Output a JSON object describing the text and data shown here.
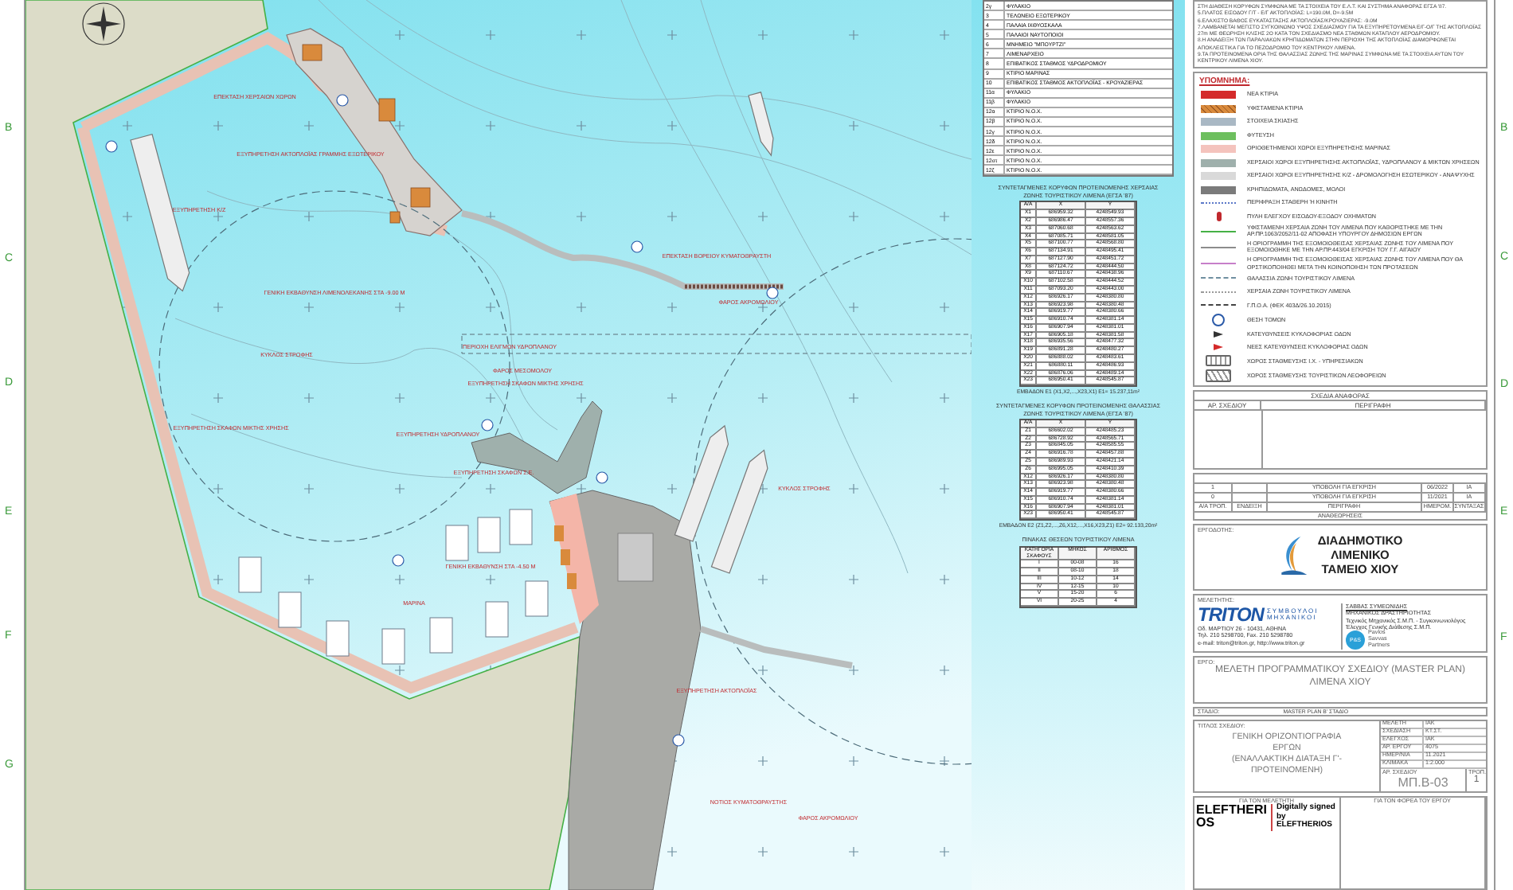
{
  "margin_letters": {
    "left": [
      "B",
      "C",
      "D",
      "E",
      "F",
      "G"
    ],
    "right": [
      "B",
      "C",
      "D",
      "E",
      "F"
    ]
  },
  "map": {
    "labels": [
      "ΕΠΕΚΤΑΣΗ ΧΕΡΣΑΙΩΝ ΧΩΡΩΝ",
      "ΕΞΥΠΗΡΕΤΗΣΗ ΑΚΤΟΠΛΟΪΑΣ ΓΡΑΜΜΗΣ ΕΞΩΤΕΡΙΚΟΥ",
      "ΕΞΥΠΗΡΕΤΗΣΗ Κ/Ζ",
      "ΓΕΝΙΚΗ ΕΚΒΑΘΥΝΣΗ ΛΙΜΕΝΟΛΕΚΑΝΗΣ ΣΤΑ -9.00 Μ",
      "ΚΥΚΛΟΣ ΣΤΡΟΦΗΣ",
      "ΕΞΥΠΗΡΕΤΗΣΗ ΣΚΑΦΩΝ ΜΙΚΤΗΣ ΧΡΗΣΗΣ",
      "ΕΞΥΠΗΡΕΤΗΣΗ ΥΔΡΟΠΛΑΝΟΥ",
      "ΕΞΥΠΗΡΕΤΗΣΗ ΣΚΑΦΩΝ Σ.Ε.",
      "ΦΑΡΟΣ ΜΕΣΟΜΟΛΟΥ",
      "ΕΞΥΠΗΡΕΤΗΣΗ ΣΚΑΦΩΝ ΜΙΚΤΗΣ ΧΡΗΣΗΣ",
      "ΓΕΝΙΚΗ ΕΚΒΑΘΥΝΣΗ ΣΤΑ -4.50 Μ",
      "ΜΑΡΙΝΑ",
      "ΕΠΕΚΤΑΣΗ ΒΟΡΕΙΟΥ ΚΥΜΑΤΟΘΡΑΥΣΤΗ",
      "ΦΑΡΟΣ ΑΚΡΟΜΩΛΙΟΥ",
      "ΠΕΡΙΟΧΗ ΕΛΙΓΜΩΝ ΥΔΡΟΠΛΑΝΟΥ",
      "ΚΥΚΛΟΣ ΣΤΡΟΦΗΣ",
      "ΕΞΥΠΗΡΕΤΗΣΗ ΑΚΤΟΠΛΟΪΑΣ",
      "ΝΟΤΙΟΣ ΚΥΜΑΤΟΘΡΑΥΣΤΗΣ",
      "ΦΑΡΟΣ ΑΚΡΟΜΩΛΙΟΥ"
    ]
  },
  "buildings_table": {
    "rows": [
      {
        "no": "2γ",
        "name": "ΦΥΛΑΚΙΟ"
      },
      {
        "no": "3",
        "name": "ΤΕΛΩΝΕΙΟ ΕΞΩΤΕΡΙΚΟΥ"
      },
      {
        "no": "4",
        "name": "ΠΑΛΑΙΑ ΙΧΘΥΟΣΚΑΛΑ"
      },
      {
        "no": "5",
        "name": "ΠΑΛΑΙΟΙ ΝΑΥΤΟΠΟΙΟΙ"
      },
      {
        "no": "6",
        "name": "ΜΝΗΜΕΙΟ \"ΜΠΟΥΡΤΖΙ\""
      },
      {
        "no": "7",
        "name": "ΛΙΜΕΝΑΡΧΕΙΟ"
      },
      {
        "no": "8",
        "name": "ΕΠΙΒΑΤΙΚΟΣ ΣΤΑΘΜΟΣ ΥΔΡΟΔΡΟΜΙΟΥ"
      },
      {
        "no": "9",
        "name": "ΚΤΙΡΙΟ ΜΑΡΙΝΑΣ"
      },
      {
        "no": "10",
        "name": "ΕΠΙΒΑΤΙΚΟΣ ΣΤΑΘΜΟΣ ΑΚΤΟΠΛΟΪΑΣ - ΚΡΟΥΑΖΙΕΡΑΣ"
      },
      {
        "no": "11α",
        "name": "ΦΥΛΑΚΙΟ"
      },
      {
        "no": "11β",
        "name": "ΦΥΛΑΚΙΟ"
      },
      {
        "no": "12α",
        "name": "ΚΤΙΡΙΟ Ν.Ο.Χ."
      },
      {
        "no": "12β",
        "name": "ΚΤΙΡΙΟ Ν.Ο.Χ."
      },
      {
        "no": "12γ",
        "name": "ΚΤΙΡΙΟ Ν.Ο.Χ."
      },
      {
        "no": "12δ",
        "name": "ΚΤΙΡΙΟ Ν.Ο.Χ."
      },
      {
        "no": "12ε",
        "name": "ΚΤΙΡΙΟ Ν.Ο.Χ."
      },
      {
        "no": "12στ",
        "name": "ΚΤΙΡΙΟ Ν.Ο.Χ."
      },
      {
        "no": "12ζ",
        "name": "ΚΤΙΡΙΟ Ν.Ο.Χ."
      }
    ]
  },
  "coordinate_tables": [
    {
      "title": "ΣΥΝΤΕΤΑΓΜΕΝΕΣ ΚΟΡΥΦΩΝ ΠΡΟΤΕΙΝΟΜΕΝΗΣ ΧΕΡΣΑΙΑΣ ΖΩΝΗΣ ΤΟΥΡΙΣΤΙΚΟΥ ΛΙΜΕΝΑ (ΕΓΣΑ '87)",
      "columns": [
        "Α/Α",
        "X",
        "Y"
      ],
      "rows": [
        [
          "X1",
          "686959.32",
          "4248549.93"
        ],
        [
          "X2",
          "686986.47",
          "4248557.36"
        ],
        [
          "X3",
          "687060.68",
          "4248563.62"
        ],
        [
          "X4",
          "687085.71",
          "4248581.05"
        ],
        [
          "X5",
          "687100.77",
          "4248568.80"
        ],
        [
          "X6",
          "687134.91",
          "4248495.41"
        ],
        [
          "X7",
          "687127.90",
          "4248451.72"
        ],
        [
          "X8",
          "687124.72",
          "4248444.50"
        ],
        [
          "X9",
          "687110.67",
          "4248438.96"
        ],
        [
          "X10",
          "687102.58",
          "4248444.52"
        ],
        [
          "X11",
          "687093.20",
          "4248443.00"
        ],
        [
          "X12",
          "686926.17",
          "4248380.80"
        ],
        [
          "X13",
          "686923.98",
          "4248380.48"
        ],
        [
          "X14",
          "686919.77",
          "4248380.66"
        ],
        [
          "X15",
          "686910.74",
          "4248381.14"
        ],
        [
          "X16",
          "686907.94",
          "4248381.01"
        ],
        [
          "X17",
          "686905.18",
          "4248381.58"
        ],
        [
          "X18",
          "686935.56",
          "4248477.32"
        ],
        [
          "X19",
          "686891.28",
          "4248480.27"
        ],
        [
          "X20",
          "686888.02",
          "4248483.61"
        ],
        [
          "X21",
          "686880.11",
          "4248486.93"
        ],
        [
          "X22",
          "686876.06",
          "4248489.14"
        ],
        [
          "X23",
          "686950.41",
          "4248545.87"
        ]
      ],
      "area": "ΕΜΒΑΔΟΝ Ε1 (Χ1,Χ2,...,Χ23,Χ1) Ε1= 15.237,11m²"
    },
    {
      "title": "ΣΥΝΤΕΤΑΓΜΕΝΕΣ ΚΟΡΥΦΩΝ ΠΡΟΤΕΙΝΟΜΕΝΗΣ ΘΑΛΑΣΣΙΑΣ ΖΩΝΗΣ ΤΟΥΡΙΣΤΙΚΟΥ ΛΙΜΕΝΑ (ΕΓΣΑ '87)",
      "columns": [
        "Α/Α",
        "X",
        "Y"
      ],
      "rows": [
        [
          "Ζ1",
          "686602.02",
          "4248485.23"
        ],
        [
          "Ζ2",
          "686728.92",
          "4248565.71"
        ],
        [
          "Ζ3",
          "686845.05",
          "4248585.55"
        ],
        [
          "Ζ4",
          "686916.78",
          "4248457.88"
        ],
        [
          "Ζ5",
          "686989.93",
          "4248421.14"
        ],
        [
          "Ζ6",
          "686995.05",
          "4248410.39"
        ],
        [
          "X12",
          "686926.17",
          "4248380.80"
        ],
        [
          "X13",
          "686923.98",
          "4248380.48"
        ],
        [
          "X14",
          "686919.77",
          "4248380.66"
        ],
        [
          "X15",
          "686910.74",
          "4248381.14"
        ],
        [
          "X16",
          "686907.94",
          "4248381.01"
        ],
        [
          "X23",
          "686950.41",
          "4248545.87"
        ]
      ],
      "area": "ΕΜΒΑΔΟΝ Ε2 (Ζ1,Ζ2,...,Ζ6,Χ12,...,Χ16,Χ23,Ζ1) Ε2= 92.133,20m²"
    }
  ],
  "berths_table": {
    "title": "ΠΙΝΑΚΑΣ ΘΕΣΕΩΝ ΤΟΥΡΙΣΤΙΚΟΥ ΛΙΜΕΝΑ",
    "columns": [
      "ΚΑΤΗΓΟΡΙΑ ΣΚΑΦΟΥΣ",
      "ΜΗΚΟΣ",
      "ΑΡΙΘΜΟΣ"
    ],
    "rows": [
      [
        "I",
        "00-08",
        "16"
      ],
      [
        "II",
        "08-10",
        "18"
      ],
      [
        "III",
        "10-12",
        "14"
      ],
      [
        "IV",
        "12-15",
        "10"
      ],
      [
        "V",
        "15-20",
        "6"
      ],
      [
        "VI",
        "20-25",
        "4"
      ]
    ]
  },
  "notes": [
    "ΣΤΗ ΔΙΑΘΕΣΗ ΚΟΡΥΦΩΝ ΣΥΜΦΩΝΑ ΜΕ ΤΑ ΣΤΟΙΧΕΙΑ ΤΟΥ Ε.Λ.Τ. ΚΑΙ ΣΥΣΤΗΜΑ ΑΝΑΦΟΡΑΣ ΕΓΣΑ '87.",
    "5.ΠΛΑΤΟΣ ΕΙΣΟΔΟΥ Γ/Τ - Ε/Γ ΑΚΤΟΠΛΟΪΑΣ: L=190.0Μ, D=-9.5Μ",
    "6.ΕΛΑΧΙΣΤΟ ΒΑΘΟΣ ΕΥΚΑΤΑΣΤΑΣΗΣ ΑΚΤΟΠΛΟΪΑΣ/ΚΡΟΥΑΖΙΕΡΑΣ: -9.0Μ",
    "7.ΛΑΜΒΑΝΕΤΑΙ ΜΕΓΙΣΤΟ ΣΥΓΚΟΙΝΩΝΟ ΥΨΟΣ ΣΧΕΔΙΑΣΜΟΥ ΓΙΑ ΤΑ ΕΞΥΠΗΡΕΤΟΥΜΕΝΑ Ε/Γ-Ο/Γ ΤΗΣ ΑΚΤΟΠΛΟΪΑΣ 27m ΜΕ ΘΕΩΡΗΣΗ ΚΛΙΣΗΣ 2Ο ΚΑΤΑ ΤΟΝ ΣΧΕΔΙΑΣΜΟ ΝΕΑ ΣΤΑΘΜΩΝ ΚΑΤΑΠΛΟΥ ΑΕΡΟΔΡΟΜΙΟΥ.",
    "8.Η ΑΝΑΔΕΙΞΗ ΤΩΝ ΠΑΡΑΛΙΑΚΩΝ ΚΡΗΠΙΔΩΜΑΤΩΝ ΣΤΗΝ ΠΕΡΙΟΧΗ ΤΗΣ ΑΚΤΟΠΛΟΪΑΣ ΔΙΑΜΟΡΦΩΝΕΤΑΙ ΑΠΟΚΛΕΙΣΤΙΚΑ ΓΙΑ ΤΟ ΠΕΖΟΔΡΟΜΙΟ ΤΟΥ ΚΕΝΤΡΙΚΟΥ ΛΙΜΕΝΑ.",
    "9.ΤΑ ΠΡΟΤΕΙΝΟΜΕΝΑ ΟΡΙΑ ΤΗΣ ΘΑΛΑΣΣΙΑΣ ΖΩΝΗΣ ΤΗΣ ΜΑΡΙΝΑΣ ΣΥΜΦΩΝΑ ΜΕ ΤΑ ΣΤΟΙΧΕΙΑ ΑΥΤΩΝ ΤΟΥ ΚΕΝΤΡΙΚΟΥ ΛΙΜΕΝΑ ΧΙΟΥ."
  ],
  "legend": {
    "title": "ΥΠΟΜΝΗΜΑ:",
    "items": [
      {
        "kind": "swatch",
        "color": "#d42a2a",
        "label": "ΝΕΑ ΚΤΙΡΙΑ"
      },
      {
        "kind": "hatch",
        "color": "#d98a3c",
        "label": "ΥΦΙΣΤΑΜΕΝΑ ΚΤΙΡΙΑ"
      },
      {
        "kind": "swatch",
        "color": "#a9b8c4",
        "label": "ΣΤΟΙΧΕΙΑ ΣΚΙΑΣΗΣ"
      },
      {
        "kind": "swatch",
        "color": "#6dbf5e",
        "label": "ΦΥΤΕΥΣΗ"
      },
      {
        "kind": "swatch",
        "color": "#f4c3bd",
        "label": "ΟΡΙΟΘΕΤΗΜΕΝΟΙ ΧΩΡΟΙ ΕΞΥΠΗΡΕΤΗΣΗΣ ΜΑΡΙΝΑΣ"
      },
      {
        "kind": "swatch",
        "color": "#9fb0ac",
        "label": "ΧΕΡΣΑΙΟΙ ΧΩΡΟΙ ΕΞΥΠΗΡΕΤΗΣΗΣ ΑΚΤΟΠΛΟΪΑΣ, ΥΔΡΟΠΛΑΝΟΥ & ΜΙΚΤΩΝ ΧΡΗΣΕΩΝ"
      },
      {
        "kind": "swatch",
        "color": "#d9d9d9",
        "label": "ΧΕΡΣΑΙΟΙ ΧΩΡΟΙ ΕΞΥΠΗΡΕΤΗΣΗΣ Κ/Ζ - ΔΡΟΜΟΛΟΓΗΣΗ ΕΣΩΤΕΡΙΚΟΥ - ΑΝΑΨΥΧΗΣ"
      },
      {
        "kind": "swatch",
        "color": "#7b7b7b",
        "label": "ΚΡΗΠΙΔΩΜΑΤΑ, ΑΝΩΔΟΜΕΣ, ΜΟΛΟΙ"
      },
      {
        "kind": "dotted",
        "color": "#5b78c8",
        "label": "ΠΕΡΙΦΡΑΞΗ ΣΤΑΘΕΡΗ Ή ΚΙΝΗΤΗ"
      },
      {
        "kind": "gate",
        "color": "#c0282d",
        "label": "ΠΥΛΗ ΕΛΕΓΧΟΥ ΕΙΣΟΔΟΥ-ΕΞΟΔΟΥ ΟΧΗΜΑΤΩΝ"
      },
      {
        "kind": "line",
        "color": "#45b045",
        "label": "ΥΦΙΣΤΑΜΕΝΗ ΧΕΡΣΑΙΑ ΖΩΝΗ ΤΟΥ ΛΙΜΕΝΑ ΠΟΥ ΚΑΘΟΡΙΣΤΗΚΕ ΜΕ ΤΗΝ ΑΡ.ΠΡ.1063/2052/11-02 ΑΠΟΦΑΣΗ ΥΠΟΥΡΓΟΥ ΔΗΜΟΣΙΩΝ ΕΡΓΩΝ"
      },
      {
        "kind": "line",
        "color": "#8c8c8c",
        "label": "Η ΟΡΙΟΓΡΑΜΜΗ ΤΗΣ ΕΞΟΜΟΙΩΘΕΙΣΑΣ ΧΕΡΣΑΙΑΣ ΖΩΝΗΣ ΤΟΥ ΛΙΜΕΝΑ ΠΟΥ ΕΞΟΜΟΙΩΘΗΚΕ ΜΕ ΤΗΝ ΑΡ.ΠΡ.443/04 ΕΓΚΡΙΣΗ ΤΟΥ Γ.Γ. ΑΙΓΑΙΟΥ"
      },
      {
        "kind": "line",
        "color": "#c77fc9",
        "label": "Η ΟΡΙΟΓΡΑΜΜΗ ΤΗΣ ΕΞΟΜΟΙΩΘΕΙΣΑΣ ΧΕΡΣΑΙΑΣ ΖΩΝΗΣ ΤΟΥ ΛΙΜΕΝΑ ΠΟΥ ΘΑ ΟΡΣΤΙΚΟΠΟΙΗΘΕΙ ΜΕΤΑ ΤΗΝ ΚΟΙΝΟΠΟΙΗΣΗ ΤΩΝ ΠΡΟΤΑΣΕΩΝ"
      },
      {
        "kind": "dashed",
        "color": "#6f8fa0",
        "label": "ΘΑΛΑΣΣΙΑ ΖΩΝΗ ΤΟΥΡΙΣΤΙΚΟΥ ΛΙΜΕΝΑ"
      },
      {
        "kind": "dotted",
        "color": "#9a9a9a",
        "label": "ΧΕΡΣΑΙΑ ΖΩΝΗ ΤΟΥΡΙΣΤΙΚΟΥ ΛΙΜΕΝΑ"
      },
      {
        "kind": "dashed",
        "color": "#444444",
        "label": "Γ.Π.Ο.Α. (ΦΕΚ 403Δ/26.10.2015)"
      },
      {
        "kind": "section",
        "color": "#2b5aa8",
        "label": "ΘΕΣΗ ΤΟΜΩΝ"
      },
      {
        "kind": "arrow",
        "color": "#333333",
        "label": "ΚΑΤΕΥΘΥΝΣΕΙΣ ΚΥΚΛΟΦΟΡΙΑΣ ΟΔΩΝ"
      },
      {
        "kind": "arrow",
        "color": "#d42a2a",
        "label": "ΝΕΕΣ ΚΑΤΕΥΘΥΝΣΕΙΣ ΚΥΚΛΟΦΟΡΙΑΣ ΟΔΩΝ"
      },
      {
        "kind": "cars",
        "color": "#666666",
        "label": "ΧΩΡΟΣ ΣΤΑΘΜΕΥΣΗΣ Ι.Χ. - ΥΠΗΡΕΣΙΑΚΩΝ"
      },
      {
        "kind": "buses",
        "color": "#666666",
        "label": "ΧΩΡΟΣ ΣΤΑΘΜΕΥΣΗΣ ΤΟΥΡΙΣΤΙΚΩΝ ΛΕΩΦΟΡΕΙΩΝ"
      }
    ]
  },
  "reference_drawings": {
    "title": "ΣΧΕΔΙΑ ΑΝΑΦΟΡΑΣ",
    "columns": [
      "ΑΡ. ΣΧΕΔΙΟΥ",
      "ΠΕΡΙΓΡΑΦΗ"
    ]
  },
  "revisions": {
    "rows": [
      [
        "1",
        "",
        "ΥΠΟΒΟΛΗ ΓΙΑ ΕΓΚΡΙΣΗ",
        "06/2022",
        "ΙΑ"
      ],
      [
        "0",
        "",
        "ΥΠΟΒΟΛΗ ΓΙΑ ΕΓΚΡΙΣΗ",
        "11/2021",
        "ΙΑ"
      ]
    ],
    "bottom_header": [
      "Α/Α ΤΡΟΠ.",
      "ΕΝΔΕΙΞΗ",
      "ΠΕΡΙΓΡΑΦΗ",
      "ΗΜΕΡΟΜ.",
      "ΣΥΝΤΑΞΑΣ"
    ],
    "caption": "ΑΝΑΘΕΩΡΗΣΕΙΣ"
  },
  "client": {
    "label": "ΕΡΓΟΔΟΤΗΣ:",
    "name": [
      "ΔΙΑΔΗΜΟΤΙΚΟ",
      "ΛΙΜΕΝΙΚΟ",
      "ΤΑΜΕΙΟ ΧΙΟΥ"
    ]
  },
  "consultant": {
    "label": "ΜΕΛΕΤΗΤΗΣ:",
    "brand": "TRITON",
    "tagline": [
      "ΣΥΜΒΟΥΛΟΙ",
      "ΜΗΧΑΝΙΚΟΙ"
    ],
    "address": [
      "Οδ. ΜΑΡΤΙΟΥ 26 - 10431, ΑΘΗΝΑ",
      "Τηλ. 210 5298700, Fax. 210 5298780",
      "e-mail: triton@triton.gr, http://www.triton.gr"
    ],
    "partner_lines": [
      "ΣΑΒΒΑΣ ΣΥΜΕΩΝΙΔΗΣ",
      "ΜΗΧΑΝΙΚΟΣ ΔΡΑΣΤΗΡΙΟΤΗΤΑΣ",
      "Τεχνικός Μηχανικός Σ.Μ.Π. - Συγκοινωνιολόγος",
      "Έλεγχος Γενικής Διάθεσης Σ.Μ.Π."
    ],
    "partner_badge": "P&S",
    "partner_name": [
      "Pavlos",
      "Savvas",
      "Partners"
    ]
  },
  "project": {
    "label": "ΕΡΓΟ:",
    "title": "ΜΕΛΕΤΗ ΠΡΟΓΡΑΜΜΑΤΙΚΟΥ ΣΧΕΔΙΟΥ (MASTER PLAN) ΛΙΜΕΝΑ ΧΙΟΥ"
  },
  "stage": {
    "label": "ΣΤΑΔΙΟ:",
    "value": "MASTER PLAN Β' ΣΤΑΔΙΟ"
  },
  "drawing": {
    "label": "ΤΙΤΛΟΣ ΣΧΕΔΙΟΥ:",
    "title": [
      "ΓΕΝΙΚΗ ΟΡΙΖΟΝΤΙΟΓΡΑΦΙΑ",
      "ΕΡΓΩΝ",
      "(ΕΝΑΛΛΑΚΤΙΚΗ ΔΙΑΤΑΞΗ Γ'-",
      "ΠΡΟΤΕΙΝΟΜΕΝΗ)"
    ],
    "info": [
      [
        "ΜΕΛΕΤΗ",
        "ΙΑΚ"
      ],
      [
        "ΣΧΕΔΙΑΣΗ",
        "ΚΤ.ΣΤ."
      ],
      [
        "ΕΛΕΓΧΟΣ",
        "ΙΑΚ"
      ],
      [
        "ΑΡ. ΕΡΓΟΥ",
        "4075"
      ],
      [
        "ΗΜΕΡ/ΝΙΑ",
        "11.2021"
      ],
      [
        "ΚΛΙΜΑΚΑ",
        "1:2.000"
      ]
    ],
    "number_label": "ΑΡ. ΣΧΕΔΙΟΥ",
    "number": "ΜΠ.Β-03",
    "rev_label": "ΤΡΟΠ.",
    "rev": "1"
  },
  "signatures": {
    "designer": "ΓΙΑ ΤΟΝ ΜΕΛΕΤΗΤΗ",
    "owner": "ΓΙΑ ΤΟΝ ΦΟΡΕΑ ΤΟΥ ΕΡΓΟΥ",
    "signer": [
      "ELEFTHERI",
      "OS"
    ],
    "signature_note": [
      "Digitally signed",
      "by ELEFTHERIOS"
    ]
  }
}
